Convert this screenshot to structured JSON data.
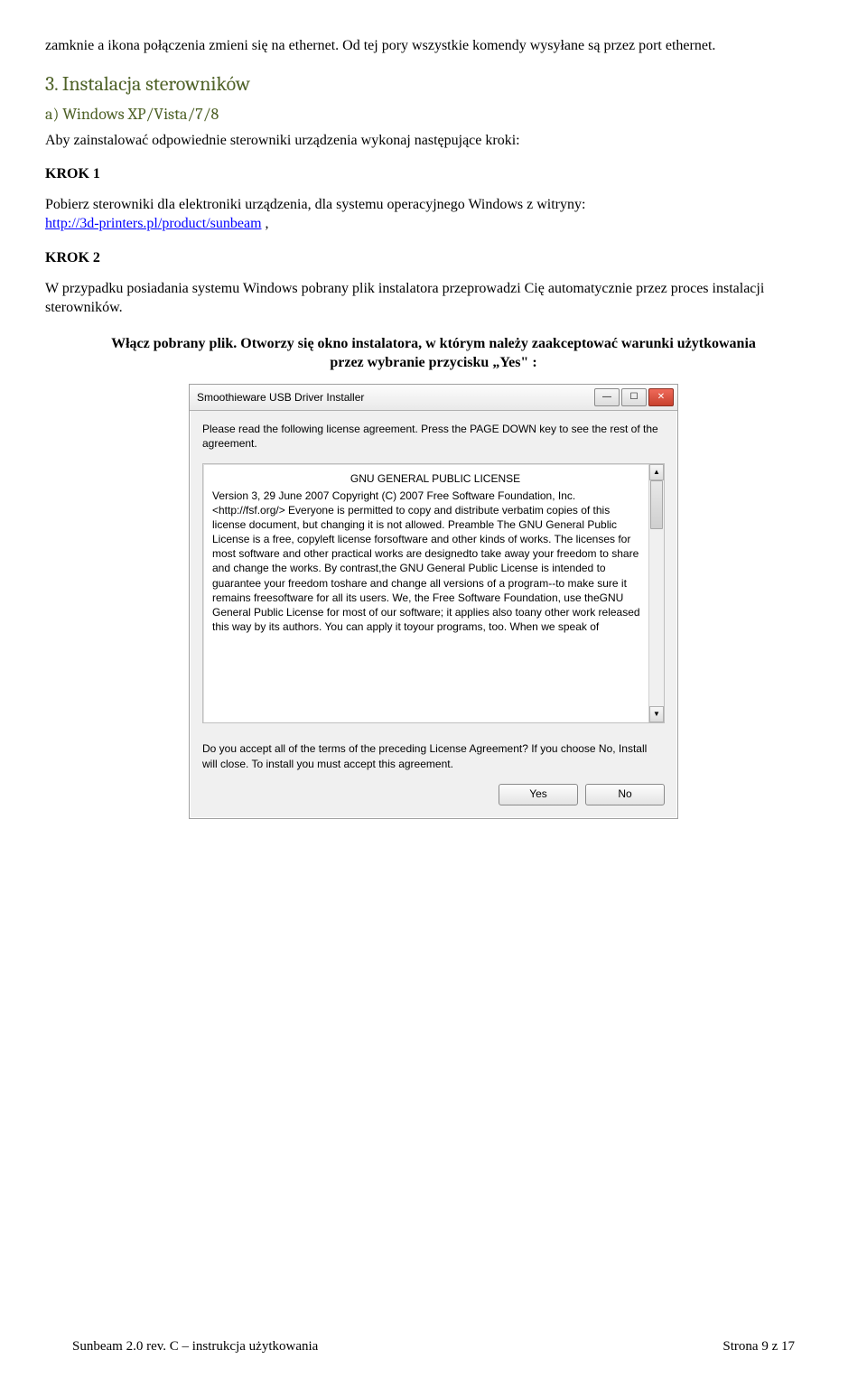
{
  "intro": "zamknie a ikona połączenia zmieni się na ethernet. Od tej pory wszystkie komendy wysyłane są przez port ethernet.",
  "heading3": "3. Instalacja sterowników",
  "subA": "a) Windows XP/Vista/7/8",
  "subA_line": "Aby zainstalować odpowiednie sterowniki urządzenia wykonaj następujące kroki:",
  "krok1_label": "KROK 1",
  "krok1_text_pre": "Pobierz sterowniki dla elektroniki urządzenia, dla systemu operacyjnego Windows z witryny: ",
  "krok1_link": "http://3d-printers.pl/product/sunbeam",
  "krok1_text_post": " ,",
  "krok2_label": "KROK 2",
  "krok2_text": "W przypadku posiadania systemu Windows pobrany plik instalatora przeprowadzi Cię automatycznie przez proces instalacji sterowników.",
  "center_bold": "Włącz pobrany plik. Otworzy się okno instalatora, w którym należy zaakceptować warunki użytkowania przez wybranie przycisku „Yes\" :",
  "dialog": {
    "title": "Smoothieware USB Driver Installer",
    "instruction": "Please read the following license agreement. Press the PAGE DOWN key to see the rest of the agreement.",
    "license": {
      "title": "GNU GENERAL PUBLIC LICENSE",
      "ver": "Version 3, 29 June 2007 Copyright (C) 2007 Free Software Foundation, Inc. <http://fsf.org/> Everyone is permitted to copy and distribute verbatim copies of this license document, but changing it is not allowed.                          Preamble  The GNU General Public License is a free, copyleft license forsoftware and other kinds of works.  The licenses for most software and other practical works are designedto take away your freedom to share and change the works. By contrast,the GNU General Public License is intended to guarantee your freedom toshare and change all versions of a program--to make sure it remains freesoftware for all its users.  We, the Free Software Foundation, use theGNU General Public License for most of our software; it applies also toany other work released this way by its authors.  You can apply it toyour programs, too.  When we speak of"
    },
    "accept_q": "Do you accept all of the terms of the preceding License Agreement? If you choose No, Install will close. To install you must accept this agreement.",
    "yes": "Yes",
    "no": "No"
  },
  "footer": {
    "left": "Sunbeam 2.0 rev. C – instrukcja użytkowania",
    "right": "Strona 9 z 17"
  }
}
